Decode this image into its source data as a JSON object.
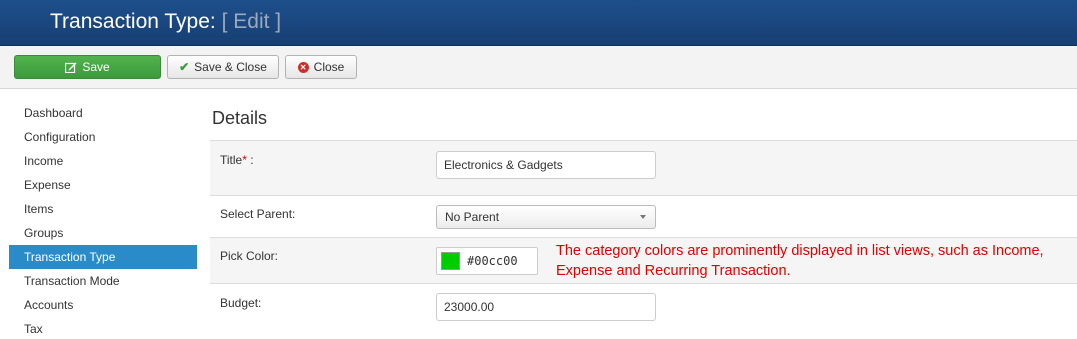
{
  "header": {
    "title": "Transaction Type:",
    "mode": "[ Edit ]"
  },
  "toolbar": {
    "save_label": "Save",
    "save_close_label": "Save & Close",
    "close_label": "Close"
  },
  "sidebar": {
    "items": [
      {
        "label": "Dashboard"
      },
      {
        "label": "Configuration"
      },
      {
        "label": "Income"
      },
      {
        "label": "Expense"
      },
      {
        "label": "Items"
      },
      {
        "label": "Groups"
      },
      {
        "label": "Transaction Type"
      },
      {
        "label": "Transaction Mode"
      },
      {
        "label": "Accounts"
      },
      {
        "label": "Tax"
      }
    ],
    "active_index": 6
  },
  "details": {
    "heading": "Details",
    "title_label": "Title",
    "title_required": "*",
    "title_suffix": " :",
    "title_value": "Electronics & Gadgets",
    "parent_label": "Select Parent:",
    "parent_value": "No Parent",
    "color_label": "Pick Color:",
    "color_value": "#00cc00",
    "color_note": "The category colors are prominently displayed in list views, such as Income, Expense and Recurring Transaction.",
    "budget_label": "Budget:",
    "budget_value": "23000.00"
  },
  "colors": {
    "header_bg": "#1d4f8c",
    "save_button": "#4cae4c",
    "active_sidebar": "#2a8bc9",
    "note_text": "#e00000",
    "picked_color": "#00cc00"
  },
  "icons": {
    "save": "edit-icon",
    "save_close": "check-icon",
    "close": "close-circle-icon",
    "select": "chevron-down-icon"
  }
}
